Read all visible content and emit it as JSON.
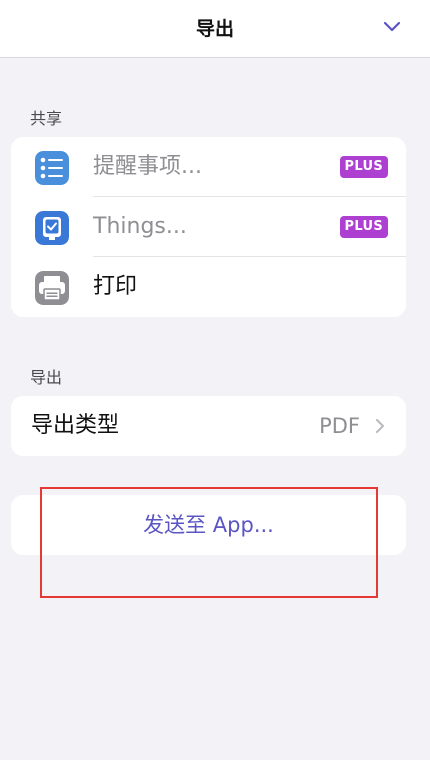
{
  "header": {
    "title": "导出"
  },
  "share_section": {
    "label": "共享",
    "items": [
      {
        "label": "提醒事项...",
        "badge": "PLUS",
        "icon": "reminders-icon"
      },
      {
        "label": "Things...",
        "badge": "PLUS",
        "icon": "things-icon"
      },
      {
        "label": "打印",
        "icon": "printer-icon"
      }
    ]
  },
  "export_section": {
    "label": "导出",
    "type_label": "导出类型",
    "type_value": "PDF"
  },
  "send_to_app": {
    "label": "发送至 App..."
  },
  "colors": {
    "accent": "#5b55c3",
    "plus_badge": "#ad3fd1",
    "highlight_box": "#e53935"
  }
}
